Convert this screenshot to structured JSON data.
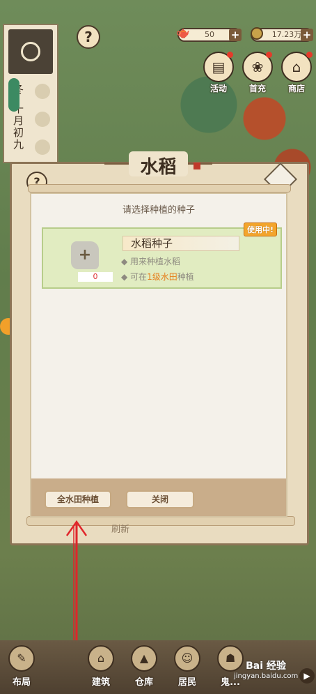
{
  "hud": {
    "help_symbol": "?",
    "resource1_value": "50",
    "resource2_value": "17.23万",
    "plus_symbol": "+",
    "menu": [
      {
        "label": "活动",
        "icon": "activity-scroll-icon"
      },
      {
        "label": "首充",
        "icon": "first-recharge-bag-icon"
      },
      {
        "label": "商店",
        "icon": "shop-stall-icon"
      }
    ]
  },
  "calendar": {
    "season": "冬",
    "date": "十月初九"
  },
  "dialog": {
    "title": "水稻",
    "prompt": "请选择种植的种子",
    "behind_text": "刷新",
    "seed": {
      "name": "水稻种子",
      "count": "0",
      "status_badge": "使用中!",
      "desc1": "用来种植水稻",
      "desc2_prefix": "可在",
      "desc2_highlight": "1级水田",
      "desc2_suffix": "种植"
    },
    "buttons": {
      "plant_all": "全水田种植",
      "close": "关闭"
    }
  },
  "bottom_nav": [
    {
      "label": "布局"
    },
    {
      "label": "建筑"
    },
    {
      "label": "仓库"
    },
    {
      "label": "居民"
    },
    {
      "label": "鬼..."
    }
  ],
  "watermark": {
    "brand": "Bai 经验",
    "url": "jingyan.baidu.com"
  },
  "colors": {
    "accent_orange": "#e67d1a",
    "panel_bg": "#f4f1ea",
    "card_green": "#e1ecc1",
    "annotation_red": "#e0252a"
  }
}
